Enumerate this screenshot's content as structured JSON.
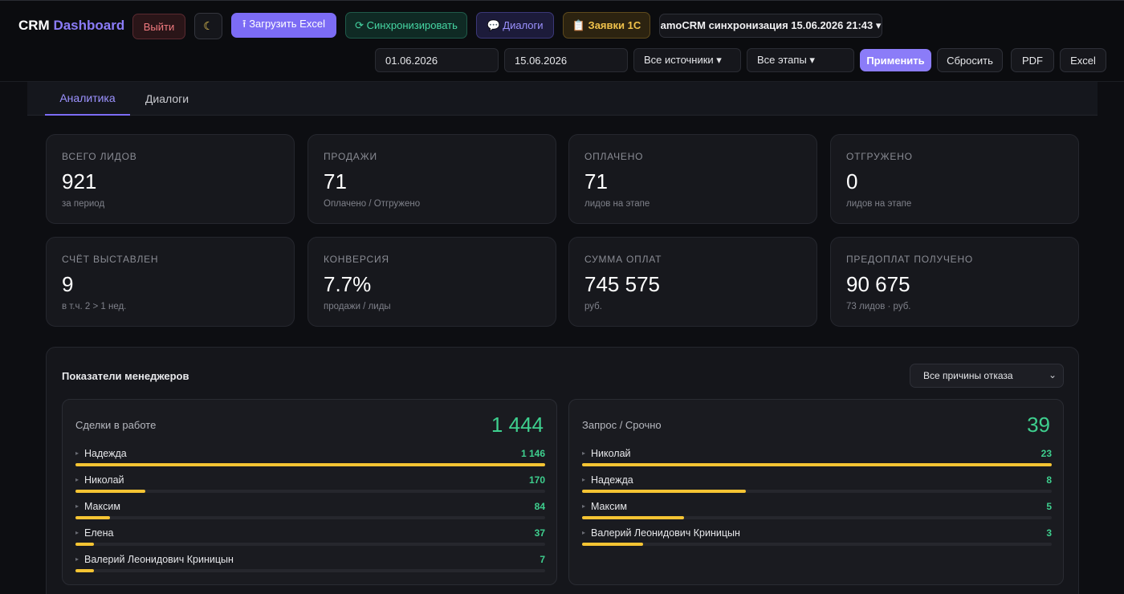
{
  "header": {
    "brand_main": "CRM",
    "brand_accent": "Dashboard",
    "logout_label": "Выйти",
    "theme_icon": "moon-icon",
    "upload_label": "⭱ Загрузить Excel",
    "sync_label": "⟳ Синхронизировать",
    "dialogs_label": "💬 Диалоги",
    "orders_label": "📋 Заявки 1С",
    "sync_info": "amoCRM синхронизация 15.06.2026 21:43 ▾"
  },
  "filters": {
    "date_from": "01.06.2026",
    "date_to": "15.06.2026",
    "source": "Все источники ▾",
    "stage": "Все этапы ▾",
    "apply_label": "Применить",
    "reset_label": "Сбросить",
    "pdf_label": "PDF",
    "excel_label": "Excel"
  },
  "tabs": [
    {
      "label": "Аналитика",
      "active": true
    },
    {
      "label": "Диалоги",
      "active": false
    }
  ],
  "cards": [
    {
      "label": "ВСЕГО ЛИДОВ",
      "value": "921",
      "sub": "за период"
    },
    {
      "label": "ПРОДАЖИ",
      "value": "71",
      "sub": "Оплачено / Отгружено"
    },
    {
      "label": "ОПЛАЧЕНО",
      "value": "71",
      "sub": "лидов на этапе"
    },
    {
      "label": "ОТГРУЖЕНО",
      "value": "0",
      "sub": "лидов на этапе"
    },
    {
      "label": "СЧЁТ ВЫСТАВЛЕН",
      "value": "9",
      "sub": "в т.ч. 2 > 1 нед."
    },
    {
      "label": "КОНВЕРСИЯ",
      "value": "7.7%",
      "sub": "продажи / лиды"
    },
    {
      "label": "СУММА ОПЛАТ",
      "value": "745 575",
      "sub": "руб."
    },
    {
      "label": "ПРЕДОПЛАТ ПОЛУЧЕНО",
      "value": "90 675",
      "sub": "73 лидов · руб."
    }
  ],
  "managers": {
    "title": "Показатели менеджеров",
    "reason_filter": "Все причины отказа",
    "deals": {
      "title": "Сделки в работе",
      "total": "1 444",
      "rows": [
        {
          "name": "Надежда",
          "value": "1 146",
          "share": 1.0
        },
        {
          "name": "Николай",
          "value": "170",
          "share": 0.148
        },
        {
          "name": "Максим",
          "value": "84",
          "share": 0.073
        },
        {
          "name": "Елена",
          "value": "37",
          "share": 0.04
        },
        {
          "name": "Валерий Леонидович Криницын",
          "value": "7",
          "share": 0.04
        }
      ]
    },
    "urgent": {
      "title": "Запрос / Срочно",
      "total": "39",
      "rows": [
        {
          "name": "Николай",
          "value": "23",
          "share": 1.0
        },
        {
          "name": "Надежда",
          "value": "8",
          "share": 0.348
        },
        {
          "name": "Максим",
          "value": "5",
          "share": 0.217
        },
        {
          "name": "Валерий Леонидович Криницын",
          "value": "3",
          "share": 0.13
        }
      ]
    }
  }
}
